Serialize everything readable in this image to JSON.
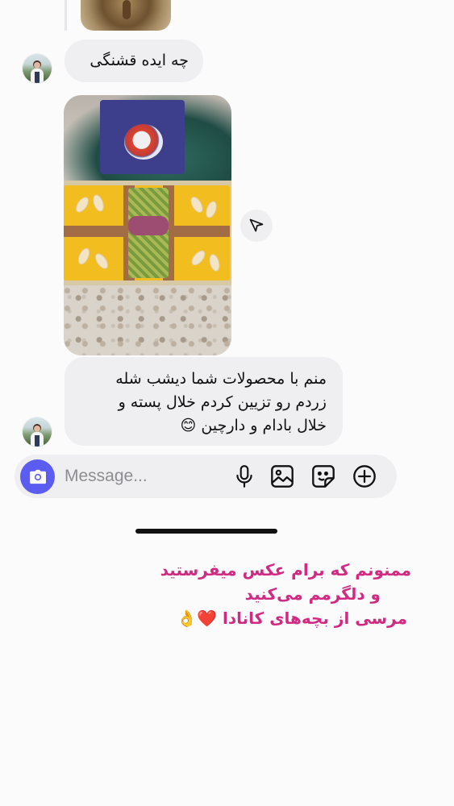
{
  "messages": [
    {
      "type": "text",
      "sender": "other",
      "text": "چه ایده قشنگی"
    },
    {
      "type": "photo",
      "sender": "other",
      "icon": "food-photo"
    },
    {
      "type": "text",
      "sender": "other",
      "text": "منم با محصولات شما دیشب شله\nزردم رو تزیین کردم خلال پسته و\nخلال بادام و دارچین 😊"
    }
  ],
  "composer": {
    "placeholder": "Message...",
    "camera_icon": "camera-icon",
    "tools": [
      "microphone-icon",
      "gallery-icon",
      "sticker-icon",
      "plus-icon"
    ]
  },
  "share_icon": "send-icon",
  "caption": {
    "line1": "ممنونم که برام عکس میفرستید",
    "line2": "و دلگرمم می‌کنید",
    "line3": "مرسی از بچه‌های کانادا ❤️👌"
  },
  "colors": {
    "accent": "#5b5cf0",
    "bubble": "#efeff1",
    "caption": "#d12a83"
  }
}
